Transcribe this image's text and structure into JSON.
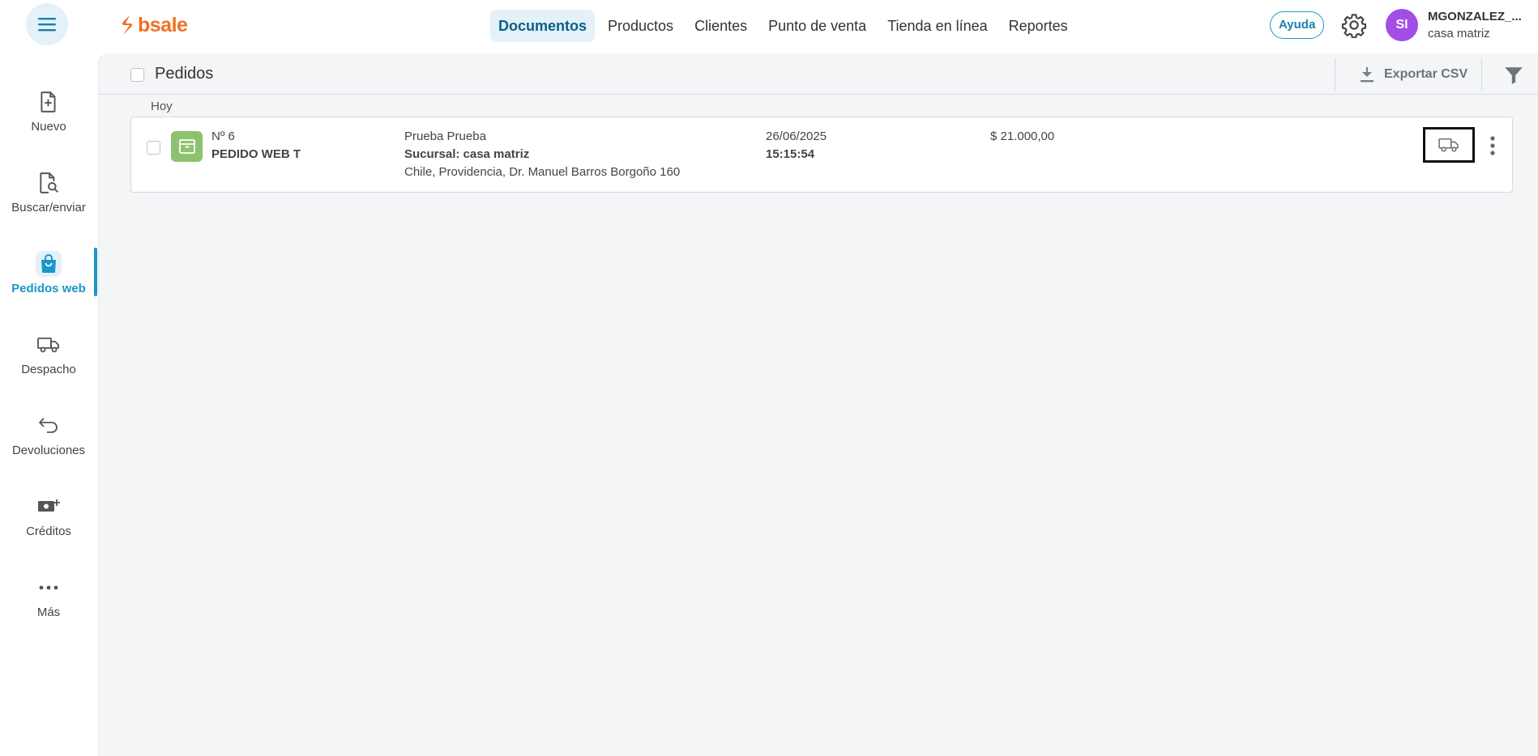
{
  "app": {
    "logo_text": "bsale",
    "brand_color": "#f36f21",
    "accent_color": "#1a96c8"
  },
  "topnav": {
    "items": [
      {
        "label": "Documentos",
        "active": true
      },
      {
        "label": "Productos"
      },
      {
        "label": "Clientes"
      },
      {
        "label": "Punto de venta"
      },
      {
        "label": "Tienda en línea"
      },
      {
        "label": "Reportes"
      }
    ],
    "help_label": "Ayuda"
  },
  "user": {
    "initials": "SI",
    "name": "MGONZALEZ_...",
    "branch": "casa matriz",
    "avatar_color": "#a24ee6"
  },
  "sidebar": {
    "items": [
      {
        "label": "Nuevo",
        "icon": "new-document-icon"
      },
      {
        "label": "Buscar/enviar",
        "icon": "search-document-icon"
      },
      {
        "label": "Pedidos web",
        "icon": "shopping-bag-icon",
        "active": true
      },
      {
        "label": "Despacho",
        "icon": "truck-icon"
      },
      {
        "label": "Devoluciones",
        "icon": "return-arrow-icon"
      },
      {
        "label": "Créditos",
        "icon": "credit-money-icon"
      },
      {
        "label": "Más",
        "icon": "more-dots-icon"
      }
    ]
  },
  "list": {
    "title": "Pedidos",
    "export_label": "Exportar CSV",
    "group_label": "Hoy",
    "rows": [
      {
        "number": "Nº 6",
        "doc_type": "PEDIDO WEB T",
        "client": "Prueba Prueba",
        "branch": "Sucursal: casa matriz",
        "address": "Chile, Providencia, Dr. Manuel Barros Borgoño 160",
        "date": "26/06/2025",
        "time": "15:15:54",
        "amount": "$ 21.000,00"
      }
    ]
  }
}
